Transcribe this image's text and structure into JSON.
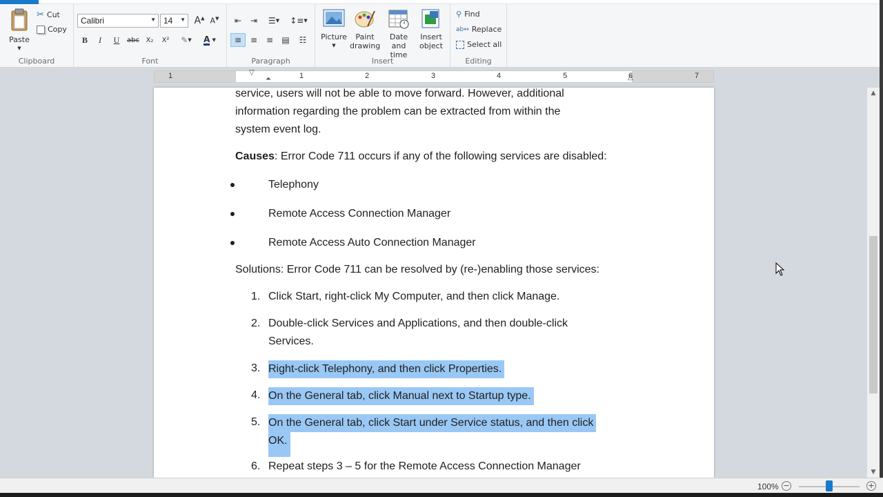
{
  "ribbon": {
    "clipboard": {
      "label": "Clipboard",
      "paste": "Paste",
      "cut": "Cut",
      "copy": "Copy"
    },
    "font": {
      "label": "Font",
      "family": "Calibri",
      "size": "14",
      "bold": "B",
      "italic": "I",
      "underline": "U",
      "strike": "abc",
      "subscript": "X₂",
      "superscript": "X²",
      "color_label": "A"
    },
    "paragraph": {
      "label": "Paragraph"
    },
    "insert": {
      "label": "Insert",
      "picture": "Picture",
      "paint_line1": "Paint",
      "paint_line2": "drawing",
      "date_line1": "Date and",
      "date_line2": "time",
      "object_line1": "Insert",
      "object_line2": "object"
    },
    "editing": {
      "label": "Editing",
      "find": "Find",
      "replace": "Replace",
      "select_all": "Select all"
    }
  },
  "ruler": {
    "numbers": [
      "1",
      "1",
      "2",
      "3",
      "4",
      "5",
      "6",
      "7"
    ]
  },
  "document": {
    "top_partial": "service, users will not be able to move forward. However, additional",
    "para1_line1": "information regarding the problem can be extracted from within the",
    "para1_line2": "system event log.",
    "causes_bold": "Causes",
    "causes_rest": ": Error Code 711 occurs if any of the following services are disabled:",
    "bullets": [
      "Telephony",
      "Remote Access Connection Manager",
      "Remote Access Auto Connection Manager"
    ],
    "solutions": "Solutions: Error Code 711 can be resolved by (re-)enabling those services:",
    "steps": [
      {
        "n": "1.",
        "lines": [
          "Click Start, right-click My Computer, and then click Manage."
        ]
      },
      {
        "n": "2.",
        "lines": [
          "Double-click Services and Applications, and then double-click",
          "Services."
        ]
      },
      {
        "n": "3.",
        "lines": [
          "Right-click Telephony, and then click Properties."
        ]
      },
      {
        "n": "4.",
        "lines": [
          "On the General tab, click Manual next to Startup type."
        ]
      },
      {
        "n": "5.",
        "lines": [
          "On the General tab, click Start under Service status, and then click",
          "OK."
        ]
      },
      {
        "n": "6.",
        "lines": [
          "Repeat steps 3 – 5 for the Remote Access Connection Manager"
        ]
      }
    ]
  },
  "status": {
    "zoom": "100%",
    "zoom_out": "−",
    "zoom_in": "+"
  },
  "colors": {
    "selection": "#99c8f5",
    "accent": "#1979ca"
  }
}
